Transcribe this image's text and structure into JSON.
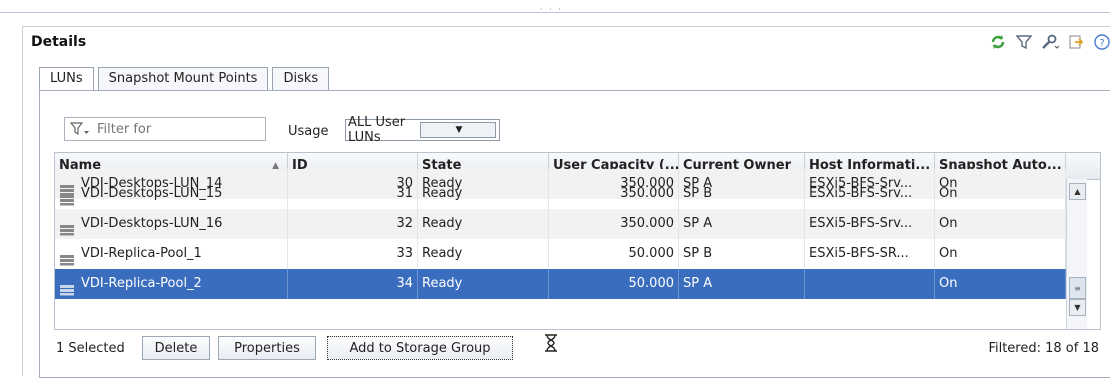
{
  "panel": {
    "title": "Details",
    "tools": [
      "refresh-icon",
      "filter-icon",
      "wrench-icon",
      "export-icon",
      "help-icon"
    ]
  },
  "tabs": [
    {
      "label": "LUNs",
      "active": true
    },
    {
      "label": "Snapshot Mount Points",
      "active": false
    },
    {
      "label": "Disks",
      "active": false
    }
  ],
  "filter": {
    "placeholder": "Filter for"
  },
  "usage": {
    "label": "Usage",
    "selected": "ALL User LUNs"
  },
  "table": {
    "columns": [
      "Name",
      "ID",
      "State",
      "User Capacity (...",
      "Current Owner",
      "Host Informati...",
      "Snapshot Auto..."
    ],
    "partial_row": {
      "name": "VDI-Desktops-LUN_14",
      "id": "30",
      "state": "Ready",
      "capacity": "350.000",
      "owner": "SP A",
      "host": "ESXi5-BFS-Srv...",
      "snapshot": "On"
    },
    "rows": [
      {
        "name": "VDI-Desktops-LUN_15",
        "id": "31",
        "state": "Ready",
        "capacity": "350.000",
        "owner": "SP B",
        "host": "ESXi5-BFS-Srv...",
        "snapshot": "On"
      },
      {
        "name": "VDI-Desktops-LUN_16",
        "id": "32",
        "state": "Ready",
        "capacity": "350.000",
        "owner": "SP A",
        "host": "ESXi5-BFS-Srv...",
        "snapshot": "On"
      },
      {
        "name": "VDI-Replica-Pool_1",
        "id": "33",
        "state": "Ready",
        "capacity": "50.000",
        "owner": "SP B",
        "host": "ESXi5-BFS-SR...",
        "snapshot": "On"
      },
      {
        "name": "VDI-Replica-Pool_2",
        "id": "34",
        "state": "Ready",
        "capacity": "50.000",
        "owner": "SP A",
        "host": "",
        "snapshot": "On"
      }
    ]
  },
  "footer": {
    "selected_text": "1 Selected",
    "delete_label": "Delete",
    "properties_label": "Properties",
    "add_to_group_label": "Add to Storage Group",
    "filtered_text": "Filtered: 18 of 18"
  },
  "colors": {
    "selection": "#3a6dbd",
    "refresh": "#3aa03a",
    "help": "#4a7bd0"
  }
}
